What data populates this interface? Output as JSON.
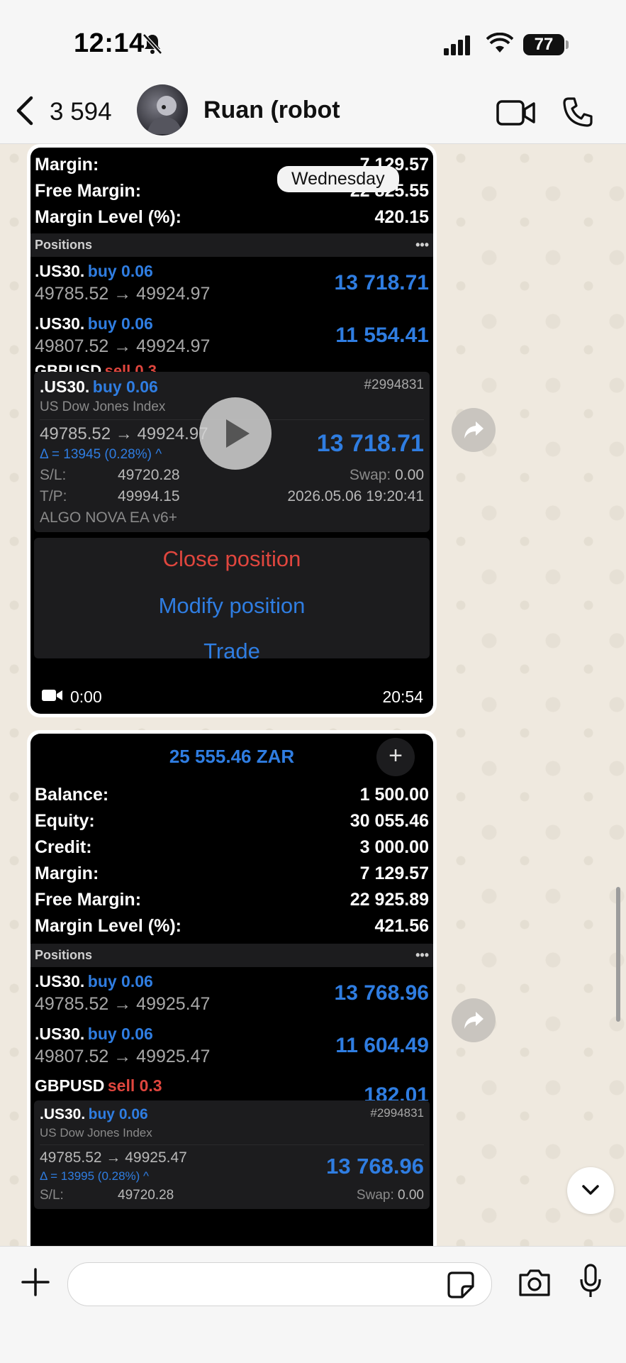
{
  "status": {
    "time": "12:14",
    "battery": "77"
  },
  "header": {
    "back_count": "3 594",
    "contact": "Ruan (robot"
  },
  "msg1": {
    "weekday": "Wednesday",
    "rows": [
      {
        "label": "Margin:",
        "value": "7 129.57"
      },
      {
        "label": "Free Margin:",
        "value": "22 825.55"
      },
      {
        "label": "Margin Level (%):",
        "value": "420.15"
      }
    ],
    "positions_label": "Positions",
    "positions": [
      {
        "symbol": ".US30.",
        "side": "buy 0.06",
        "prices": "49785.52 → 49924.97",
        "profit": "13 718.71"
      },
      {
        "symbol": ".US30.",
        "side": "buy 0.06",
        "prices": "49807.52 → 49924.97",
        "profit": "11 554.41"
      }
    ],
    "peek_symbol": "GBPUSD",
    "peek_side": "sell 0.3",
    "detail": {
      "symbol": ".US30.",
      "side": "buy 0.06",
      "ticket": "#2994831",
      "index": "US Dow Jones Index",
      "prices": "49785.52 → 49924.97",
      "profit": "13 718.71",
      "delta": "Δ = 13945 (0.28%) ^",
      "sl_label": "S/L:",
      "sl": "49720.28",
      "swap_label": "Swap:",
      "swap": "0.00",
      "tp_label": "T/P:",
      "tp": "49994.15",
      "datetime": "2026.05.06 19:20:41",
      "comment": "ALGO NOVA EA v6+"
    },
    "close": "Close position",
    "modify": "Modify position",
    "trade": "Trade",
    "video_pos": "0:00",
    "video_len": "20:54"
  },
  "msg2": {
    "balance_header": "25 555.46 ZAR",
    "rows": [
      {
        "label": "Balance:",
        "value": "1 500.00"
      },
      {
        "label": "Equity:",
        "value": "30 055.46"
      },
      {
        "label": "Credit:",
        "value": "3 000.00"
      },
      {
        "label": "Margin:",
        "value": "7 129.57"
      },
      {
        "label": "Free Margin:",
        "value": "22 925.89"
      },
      {
        "label": "Margin Level (%):",
        "value": "421.56"
      }
    ],
    "positions_label": "Positions",
    "positions": [
      {
        "symbol": ".US30.",
        "side": "buy 0.06",
        "prices": "49785.52 → 49925.47",
        "profit": "13 768.96"
      },
      {
        "symbol": ".US30.",
        "side": "buy 0.06",
        "prices": "49807.52 → 49925.47",
        "profit": "11 604.49"
      }
    ],
    "gbp": {
      "symbol": "GBPUSD",
      "side": "sell 0.3",
      "profit": "182.01"
    },
    "detail": {
      "symbol": ".US30.",
      "side": "buy 0.06",
      "ticket": "#2994831",
      "index": "US Dow Jones Index",
      "prices": "49785.52 → 49925.47",
      "profit": "13 768.96",
      "delta": "Δ = 13995 (0.28%) ^",
      "sl_label": "S/L:",
      "sl": "49720.28",
      "swap_label": "Swap:",
      "swap": "0.00"
    }
  }
}
